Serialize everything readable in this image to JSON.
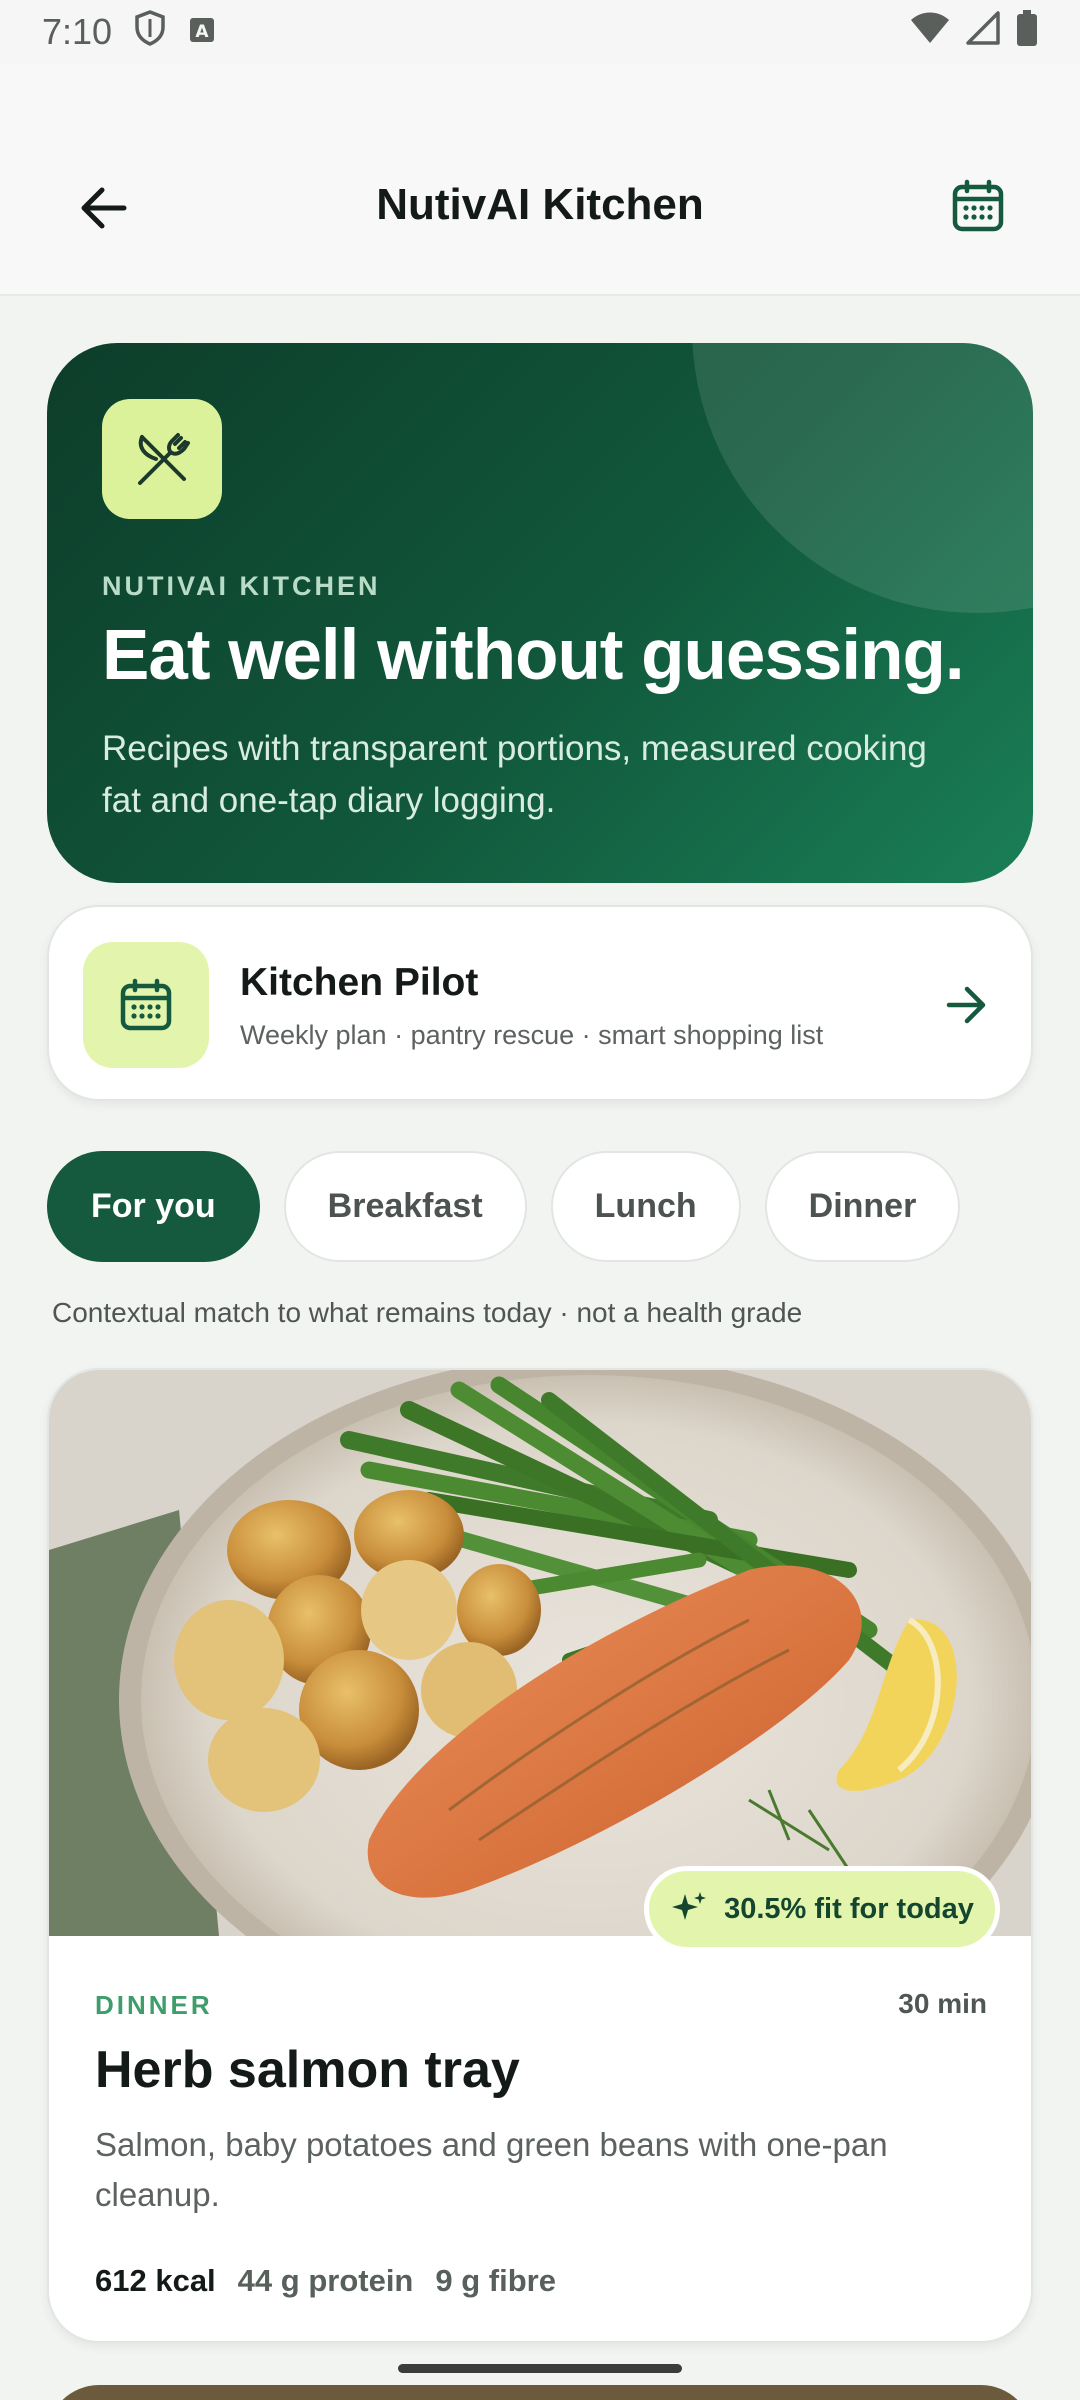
{
  "status_bar": {
    "time": "7:10"
  },
  "app_bar": {
    "title": "NutivAI Kitchen"
  },
  "hero": {
    "eyebrow": "NUTIVAI KITCHEN",
    "title": "Eat well without guessing.",
    "subtitle": "Recipes with transparent portions, measured cooking fat and one-tap diary logging."
  },
  "pilot": {
    "title": "Kitchen Pilot",
    "subtitle": "Weekly plan · pantry rescue · smart shopping list"
  },
  "chips": [
    {
      "label": "For you",
      "active": true
    },
    {
      "label": "Breakfast",
      "active": false
    },
    {
      "label": "Lunch",
      "active": false
    },
    {
      "label": "Dinner",
      "active": false
    }
  ],
  "context_note": "Contextual match to what remains today · not a health grade",
  "recipe": {
    "fit_badge": "30.5% fit for today",
    "meal": "DINNER",
    "time": "30 min",
    "title": "Herb salmon tray",
    "description": "Salmon, baby potatoes and green beans with one-pan cleanup.",
    "kcal": "612 kcal",
    "protein": "44 g protein",
    "fibre": "9 g fibre"
  },
  "colors": {
    "primary": "#155a3e",
    "accent": "#e3f5ad",
    "background": "#f2f4f2"
  }
}
